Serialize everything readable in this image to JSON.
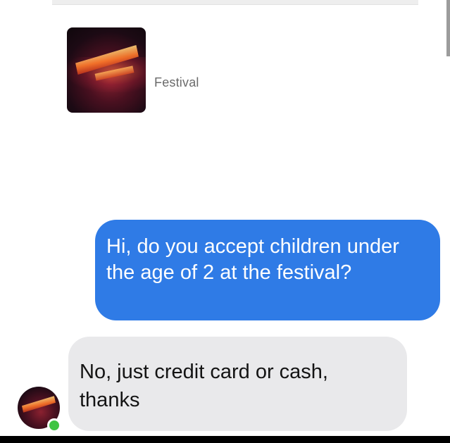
{
  "page": {
    "label": "Festival"
  },
  "messages": [
    {
      "direction": "outgoing",
      "text": "Hi, do you accept children under the age of 2 at the festival?"
    },
    {
      "direction": "incoming",
      "text": "No, just credit card or cash, thanks"
    }
  ],
  "sender": {
    "presence": "online"
  },
  "colors": {
    "outgoing_bubble": "#2f7be6",
    "incoming_bubble": "#e9e9eb",
    "presence_online": "#3ec442"
  }
}
